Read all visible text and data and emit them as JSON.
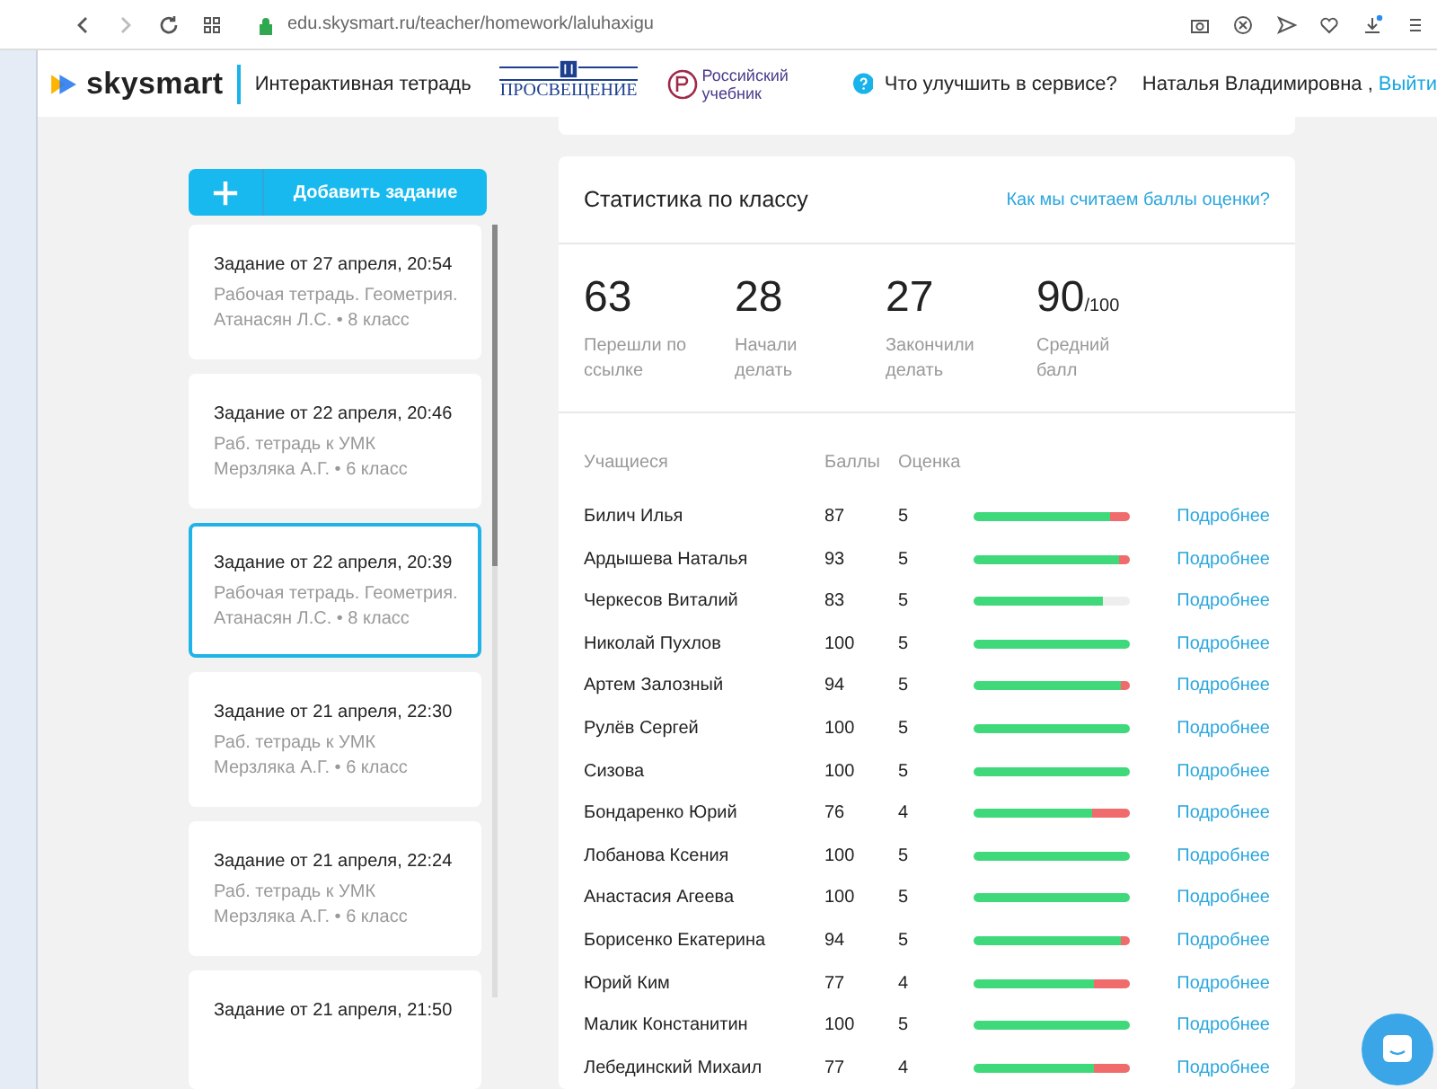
{
  "browser": {
    "url": "edu.skysmart.ru/teacher/homework/laluhaxigu"
  },
  "header": {
    "brand": "skysmart",
    "product": "Интерактивная тетрадь",
    "partner_1": "ПРОСВЕЩЕНИЕ",
    "partner_2": "Российский учебник",
    "feedback": "Что улучшить в сервисе?",
    "user": "Наталья Владимировна ,",
    "logout": "Выйти"
  },
  "add_button": {
    "label": "Добавить задание"
  },
  "assignments": [
    {
      "title": "Задание от 27 апреля, 20:54",
      "subtitle": "Рабочая тетрадь. Геометрия. Атанасян Л.С. • 8 класс",
      "selected": false
    },
    {
      "title": "Задание от 22 апреля, 20:46",
      "subtitle": "Раб. тетрадь к УМК Мерзляка А.Г. • 6 класс",
      "selected": false
    },
    {
      "title": "Задание от 22 апреля, 20:39",
      "subtitle": "Рабочая тетрадь. Геометрия. Атанасян Л.С. • 8 класс",
      "selected": true
    },
    {
      "title": "Задание от 21 апреля, 22:30",
      "subtitle": "Раб. тетрадь к УМК Мерзляка А.Г. • 6 класс",
      "selected": false
    },
    {
      "title": "Задание от 21 апреля, 22:24",
      "subtitle": "Раб. тетрадь к УМК Мерзляка А.Г. • 6 класс",
      "selected": false
    },
    {
      "title": "Задание от 21 апреля, 21:50",
      "selected": false
    }
  ],
  "stats": {
    "title": "Статистика по классу",
    "link": "Как мы считаем баллы оценки?",
    "metrics": [
      {
        "value": "63",
        "label": "Перешли по ссылке"
      },
      {
        "value": "28",
        "label": "Начали делать"
      },
      {
        "value": "27",
        "label": "Закончили делать"
      },
      {
        "value": "90",
        "suffix": "/100",
        "label": "Средний балл"
      }
    ]
  },
  "table": {
    "columns": [
      "Учащиеся",
      "Баллы",
      "Оценка"
    ],
    "rows": [
      {
        "name": "Билич Илья",
        "score": "87",
        "grade": "5",
        "level": 0.87,
        "kind": "wrong",
        "link": "Подробнее"
      },
      {
        "name": "Ардышева Наталья",
        "score": "93",
        "grade": "5",
        "level": 0.93,
        "kind": "wrong",
        "link": "Подробнее"
      },
      {
        "name": "Черкесов Виталий",
        "score": "83",
        "grade": "5",
        "level": 0.83,
        "kind": "blank",
        "link": "Подробнее"
      },
      {
        "name": "Николай Пухлов",
        "score": "100",
        "grade": "5",
        "level": 1,
        "kind": "blank",
        "link": "Подробнее"
      },
      {
        "name": "Артем Залозный",
        "score": "94",
        "grade": "5",
        "level": 0.94,
        "kind": "wrong",
        "link": "Подробнее"
      },
      {
        "name": "Рулёв Сергей",
        "score": "100",
        "grade": "5",
        "level": 1,
        "kind": "blank",
        "link": "Подробнее"
      },
      {
        "name": "Сизова",
        "score": "100",
        "grade": "5",
        "level": 1,
        "kind": "blank",
        "link": "Подробнее"
      },
      {
        "name": "Бондаренко Юрий",
        "score": "76",
        "grade": "4",
        "level": 0.76,
        "kind": "wrong",
        "link": "Подробнее"
      },
      {
        "name": "Лобанова Ксения",
        "score": "100",
        "grade": "5",
        "level": 1,
        "kind": "blank",
        "link": "Подробнее"
      },
      {
        "name": "Анастасия Агеева",
        "score": "100",
        "grade": "5",
        "level": 1,
        "kind": "blank",
        "link": "Подробнее"
      },
      {
        "name": "Борисенко Екатерина",
        "score": "94",
        "grade": "5",
        "level": 0.94,
        "kind": "wrong",
        "link": "Подробнее"
      },
      {
        "name": "Юрий Ким",
        "score": "77",
        "grade": "4",
        "level": 0.77,
        "kind": "wrong",
        "link": "Подробнее"
      },
      {
        "name": "Малик Констанитин",
        "score": "100",
        "grade": "5",
        "level": 1,
        "kind": "blank",
        "link": "Подробнее"
      },
      {
        "name": "Лебединский Михаил",
        "score": "77",
        "grade": "4",
        "level": 0.77,
        "kind": "wrong",
        "link": "Подробнее"
      }
    ]
  }
}
